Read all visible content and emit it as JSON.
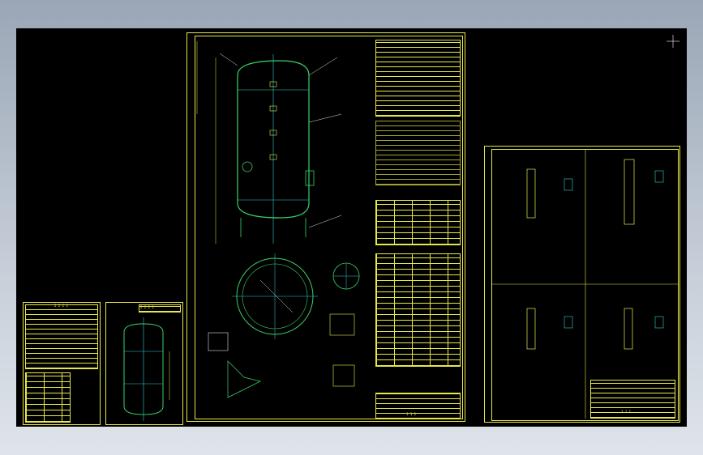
{
  "colors": {
    "background": "#000000",
    "frame": "#e8e84a",
    "vessel": "#39d36a",
    "centerline": "#2fd0d0",
    "leader": "#e0e0e0"
  },
  "viewport": {
    "name": "cad-model-space"
  },
  "sheets": [
    {
      "id": "data-sheet",
      "title_block": "2 2 2 1"
    },
    {
      "id": "small-vessel-sheet",
      "title_block": "2 2 2 1"
    },
    {
      "id": "main-drawing",
      "title_block": "1 1 1"
    },
    {
      "id": "detail-sheet",
      "title_block": "1 1 1"
    }
  ],
  "icons": [
    "crosshair-cursor-icon"
  ]
}
